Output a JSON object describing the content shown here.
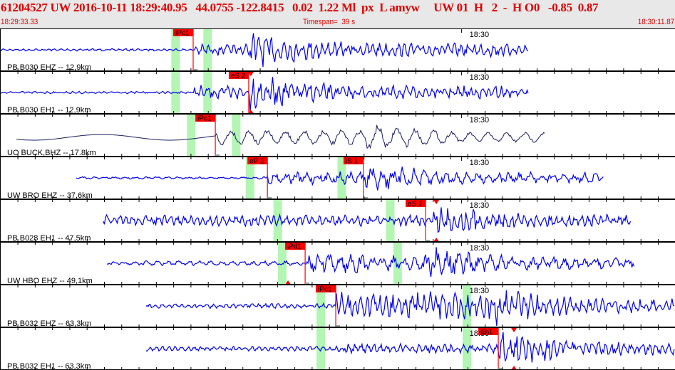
{
  "header": {
    "event_line": "61204527 UW 2016-10-11 18:29:40.95   44.0755 -122.8415   0.02  1.22 Ml  px  L amyw     UW 01  H   2  -  H O0   -0.85  0.87",
    "start_time": "18:29:33.33",
    "timespan": "Timespan=  39 s",
    "end_time": "18:30:11.87"
  },
  "timespan_s": 39,
  "minute_mark": {
    "label": "18:30",
    "t": 26.67
  },
  "colors": {
    "header_text": "#e00000",
    "trace": "#0000ee",
    "broadband_trace": "#1a1a5e",
    "pick": "#ff0000",
    "window": "#b3f5b3"
  },
  "channels": [
    {
      "label": "PB B030 EHZ -- 12,9km",
      "start": 0,
      "end": 30.56,
      "p": 11.2,
      "s": 14.4,
      "amp": [
        1.5,
        7,
        24
      ],
      "freq": 1,
      "color": "trace",
      "bands": [
        9.9,
        11.75
      ],
      "picks": [
        {
          "label": "iPc1",
          "t": 11.16,
          "tri": false
        }
      ]
    },
    {
      "label": "PB B030 EH1 -- 12,9km",
      "start": 0,
      "end": 30.56,
      "p": 11.2,
      "s": 14.4,
      "amp": [
        1.5,
        9,
        24
      ],
      "freq": 1,
      "color": "trace",
      "bands": [
        9.9,
        11.75
      ],
      "picks": [
        {
          "label": "eS 2",
          "t": 14.37,
          "tri": true
        }
      ]
    },
    {
      "label": "UO BUCK,BHZ -- 17.8km",
      "start": 0.95,
      "end": 31.5,
      "p": 12.44,
      "s": 21.2,
      "amp": [
        8,
        14,
        26
      ],
      "freq": 0.35,
      "color": "broadband_trace",
      "bands": [
        10.8,
        13.4
      ],
      "picks": [
        {
          "label": "iPc1",
          "t": 12.44,
          "tri": false
        }
      ]
    },
    {
      "label": "UW BRO EHZ -- 37,6km",
      "start": 4.4,
      "end": 34.9,
      "p": 15.45,
      "s": 21.0,
      "amp": [
        1.5,
        8,
        20
      ],
      "freq": 0.6,
      "color": "trace",
      "bands": [
        14.2,
        19.5
      ],
      "picks": [
        {
          "label": "eP 2",
          "t": 15.45,
          "tri": false
        },
        {
          "label": "iS 1",
          "t": 21.0,
          "tri": false
        }
      ]
    },
    {
      "label": "PB B028 EH1 -- 47,5km",
      "start": 5.97,
      "end": 36.45,
      "p": 5.97,
      "s": 25.0,
      "amp": [
        6,
        7,
        22
      ],
      "freq": 1,
      "color": "trace",
      "bands": [
        15.8,
        22.3
      ],
      "picks": [
        {
          "label": "eS 2",
          "t": 24.59,
          "tri": true
        }
      ]
    },
    {
      "label": "UW HBO EHZ -- 49,1km",
      "start": 6.18,
      "end": 36.65,
      "p": 17.63,
      "s": 24.6,
      "amp": [
        3,
        12,
        22
      ],
      "freq": 0.6,
      "color": "trace",
      "bands": [
        16.06,
        22.73
      ],
      "picks": [
        {
          "label": "iPd1",
          "t": 17.63,
          "tri": true
        }
      ]
    },
    {
      "label": "PB B032 EHZ -- 63,3km",
      "start": 8.44,
      "end": 39,
      "p": 19.4,
      "s": 28.7,
      "amp": [
        3,
        17,
        25
      ],
      "freq": 1,
      "color": "trace",
      "bands": [
        18.29,
        26.73
      ],
      "picks": [
        {
          "label": "iPc1",
          "t": 19.4,
          "tri": false
        }
      ]
    },
    {
      "label": "PB B032 EH1 -- 63,3km",
      "start": 8.44,
      "end": 39,
      "p": 19.4,
      "s": 28.8,
      "amp": [
        3,
        6,
        25
      ],
      "freq": 1,
      "color": "trace",
      "bands": [
        18.29,
        26.73
      ],
      "picks": [
        {
          "label": "iS 1",
          "t": 28.79,
          "tri": true
        }
      ]
    }
  ]
}
